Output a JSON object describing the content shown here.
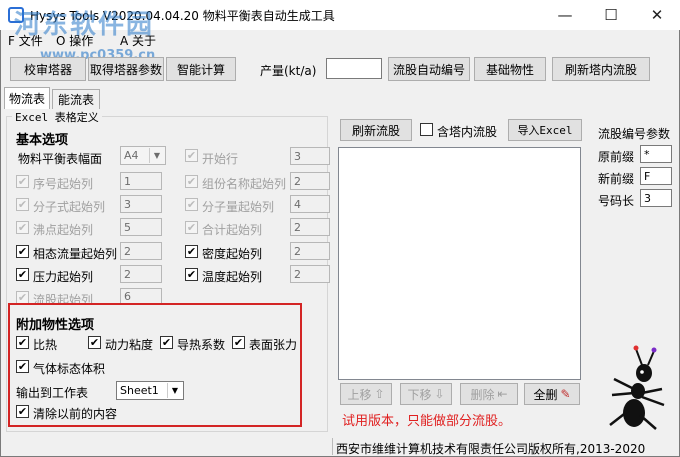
{
  "window": {
    "title": "Hysys Tools V2020.04.04.20  物料平衡表自动生成工具",
    "minimize": "—",
    "maximize": "☐",
    "close": "✕"
  },
  "watermark": {
    "main": "河东软件园",
    "url": "www.pc0359.cn"
  },
  "menu": {
    "file": "F 文件",
    "ops": "O 操作",
    "about": "A 关于"
  },
  "toolbar": {
    "validate_tower": "校审塔器",
    "get_tower_params": "取得塔器参数",
    "smart_calc": "智能计算",
    "capacity_label": "产量(kt/a)",
    "capacity_value": "",
    "auto_number": "流股自动编号",
    "basic_props": "基础物性",
    "refresh_tower": "刷新塔内流股"
  },
  "tabs": {
    "stream": "物流表",
    "energy": "能流表"
  },
  "excel_group": {
    "title": "Excel 表格定义",
    "basic_header": "基本选项",
    "page_size_label": "物料平衡表幅面",
    "page_size_value": "A4",
    "start_row_label": "开始行",
    "start_row_value": "3",
    "seq_col_label": "序号起始列",
    "seq_col_value": "1",
    "comp_name_col_label": "组份名称起始列",
    "comp_name_col_value": "2",
    "formula_col_label": "分子式起始列",
    "formula_col_value": "3",
    "mw_col_label": "分子量起始列",
    "mw_col_value": "4",
    "bp_col_label": "沸点起始列",
    "bp_col_value": "5",
    "total_col_label": "合计起始列",
    "total_col_value": "2",
    "rel_flow_col_label": "相态流量起始列",
    "rel_flow_col_value": "2",
    "density_col_label": "密度起始列",
    "density_col_value": "2",
    "pressure_col_label": "压力起始列",
    "pressure_col_value": "2",
    "temp_col_label": "温度起始列",
    "temp_col_value": "2",
    "stream_col_label": "流股起始列",
    "stream_col_value": "6"
  },
  "extra": {
    "header": "附加物性选项",
    "ratio": "比热",
    "viscosity": "动力粘度",
    "conductivity": "导热系数",
    "tension": "表面张力",
    "gas_volume": "气体标态体积",
    "output_label": "输出到工作表",
    "output_value": "Sheet1",
    "clear_label": "清除以前的内容"
  },
  "right": {
    "refresh_stream": "刷新流股",
    "include_tower": "含塔内流股",
    "import_excel": "导入Excel",
    "move_up": "上移",
    "move_down": "下移",
    "delete": "删除",
    "select_all": "全删",
    "trial_text": "试用版本，只能做部分流股。"
  },
  "numbering": {
    "title": "流股编号参数",
    "prefix_label": "原前缀",
    "prefix_value": "*",
    "new_prefix_label": "新前缀",
    "new_prefix_value": "F",
    "length_label": "号码长",
    "length_value": "3"
  },
  "status": {
    "copyright": "西安市维维计算机技术有限责任公司版权所有,2013-2020"
  }
}
